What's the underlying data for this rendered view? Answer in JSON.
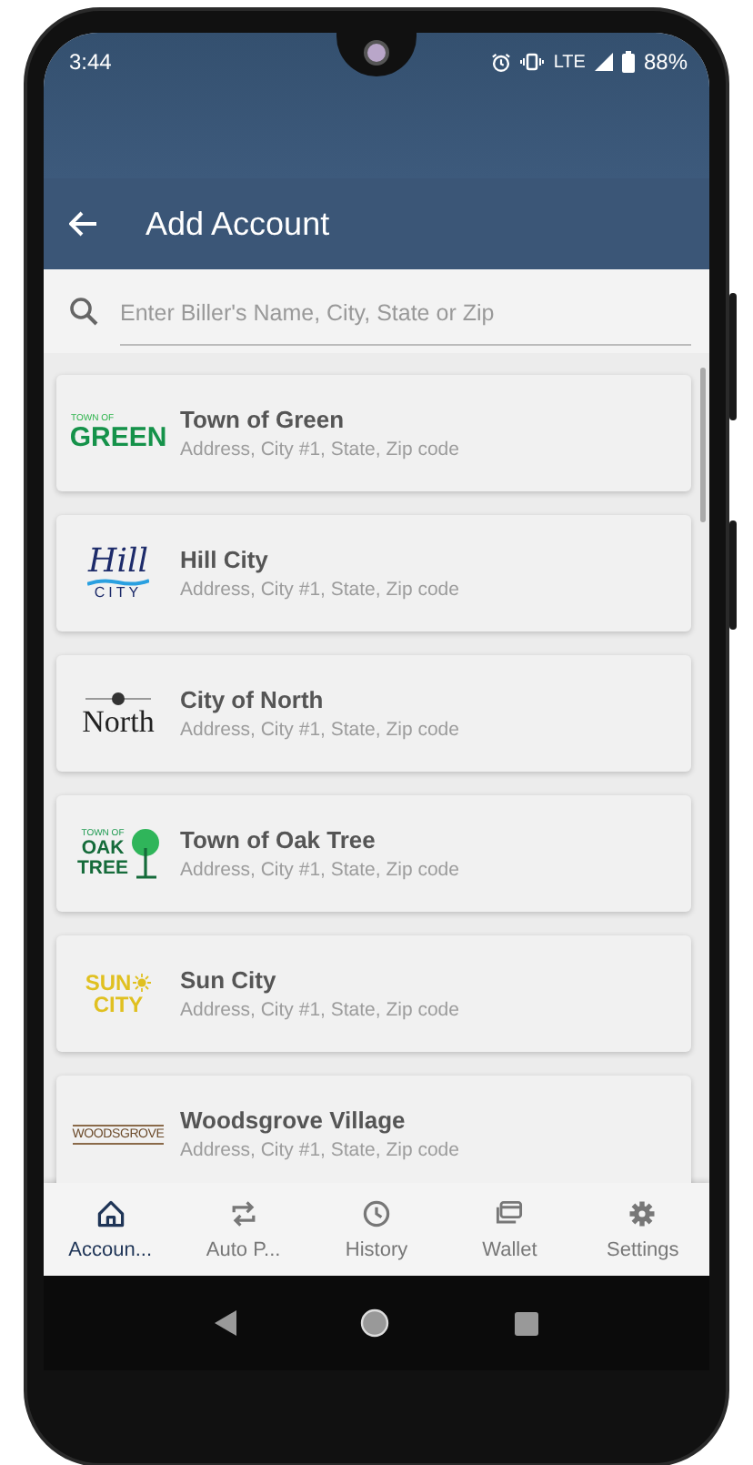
{
  "status_bar": {
    "time": "3:44",
    "network": "LTE",
    "battery": "88%"
  },
  "header": {
    "title": "Add Account"
  },
  "search": {
    "placeholder": "Enter Biller's Name, City, State or Zip"
  },
  "billers": [
    {
      "name": "Town of Green",
      "address": "Address, City #1, State, Zip code",
      "logo": {
        "kind": "green",
        "lines": [
          "TOWN OF",
          "GREEN"
        ]
      }
    },
    {
      "name": "Hill City",
      "address": "Address, City #1, State, Zip code",
      "logo": {
        "kind": "hill",
        "lines": [
          "Hill",
          "CITY"
        ]
      }
    },
    {
      "name": "City of North",
      "address": "Address, City #1, State, Zip code",
      "logo": {
        "kind": "north",
        "lines": [
          "North"
        ]
      }
    },
    {
      "name": "Town of Oak Tree",
      "address": "Address, City #1, State, Zip code",
      "logo": {
        "kind": "oak",
        "lines": [
          "TOWN OF",
          "OAK",
          "TREE"
        ]
      }
    },
    {
      "name": "Sun City",
      "address": "Address, City #1, State, Zip code",
      "logo": {
        "kind": "sun",
        "lines": [
          "SUN",
          "CITY"
        ]
      }
    },
    {
      "name": "Woodsgrove Village",
      "address": "Address, City #1, State, Zip code",
      "logo": {
        "kind": "woods",
        "lines": [
          "WOODSGROVE"
        ]
      }
    }
  ],
  "bottom_nav": [
    {
      "label": "Accoun...",
      "selected": true
    },
    {
      "label": "Auto P...",
      "selected": false
    },
    {
      "label": "History",
      "selected": false
    },
    {
      "label": "Wallet",
      "selected": false
    },
    {
      "label": "Settings",
      "selected": false
    }
  ]
}
